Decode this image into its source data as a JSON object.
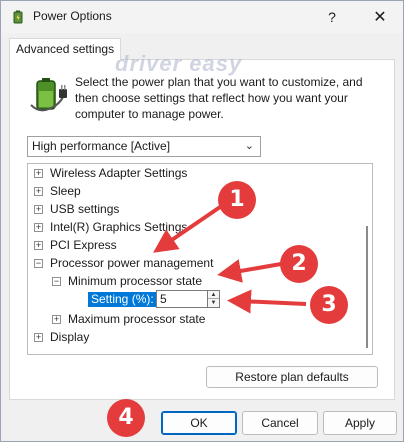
{
  "window": {
    "title": "Power Options",
    "help_label": "?",
    "close_label": "✕"
  },
  "tab": {
    "label": "Advanced settings"
  },
  "watermark": "driver easy",
  "intro_text": "Select the power plan that you want to customize, and then choose settings that reflect how you want your computer to manage power.",
  "plan_select": {
    "value": "High performance [Active]"
  },
  "tree": {
    "items": [
      {
        "label": "Wireless Adapter Settings",
        "expander": "+"
      },
      {
        "label": "Sleep",
        "expander": "+"
      },
      {
        "label": "USB settings",
        "expander": "+"
      },
      {
        "label": "Intel(R) Graphics Settings",
        "expander": "+"
      },
      {
        "label": "PCI Express",
        "expander": "+"
      },
      {
        "label": "Processor power management",
        "expander": "−"
      },
      {
        "label": "Minimum processor state",
        "expander": "−"
      },
      {
        "label": "Maximum processor state",
        "expander": "+"
      },
      {
        "label": "Display",
        "expander": "+"
      }
    ],
    "setting_label": "Setting (%):",
    "setting_value": "5"
  },
  "buttons": {
    "restore": "Restore plan defaults",
    "ok": "OK",
    "cancel": "Cancel",
    "apply": "Apply"
  },
  "annotations": [
    "1",
    "2",
    "3",
    "4"
  ],
  "colors": {
    "annotation": "#e43c3c",
    "selection": "#0078d7"
  }
}
